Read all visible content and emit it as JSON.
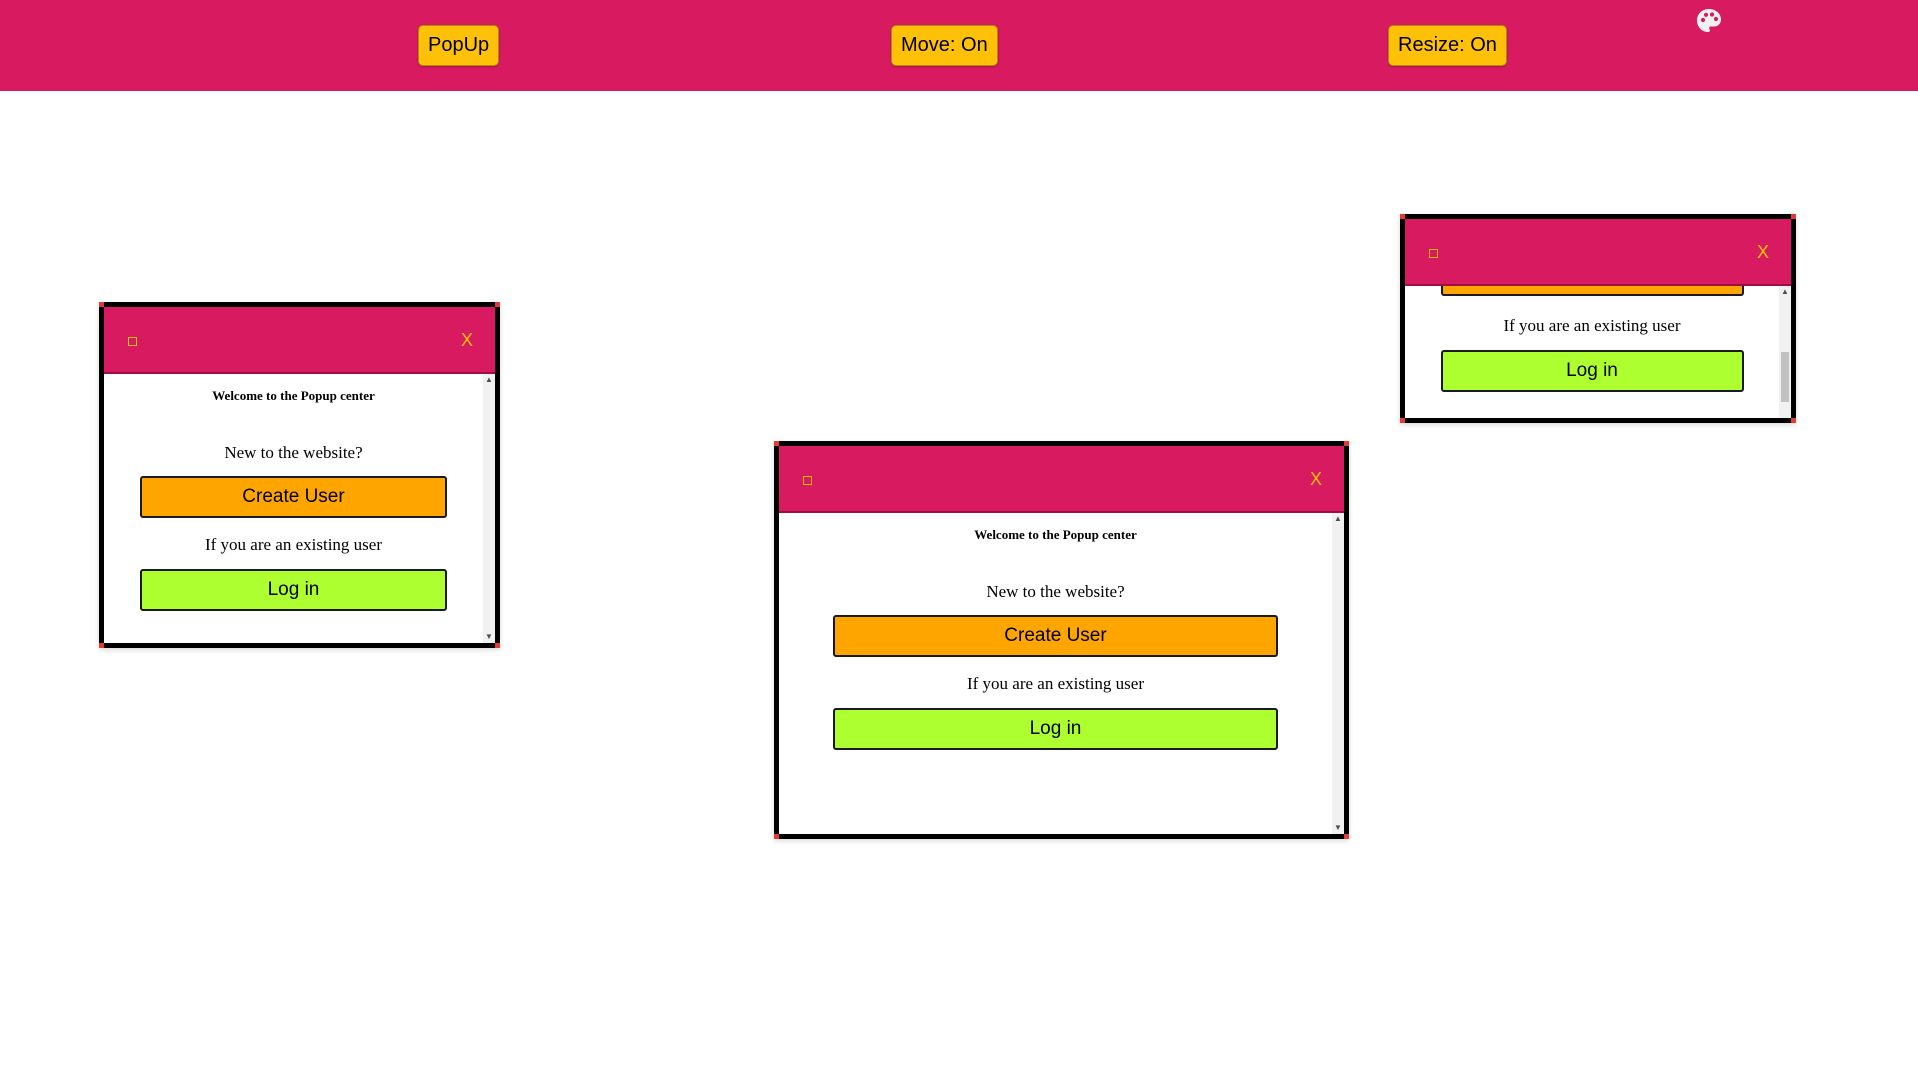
{
  "toolbar": {
    "popup_label": "PopUp",
    "move_label": "Move: On",
    "resize_label": "Resize: On",
    "theme_icon": "palette-icon"
  },
  "popups": [
    {
      "minimize_icon": "square-icon",
      "close_label": "X",
      "welcome": "Welcome to the Popup center",
      "new_question": "New to the website?",
      "create_label": "Create User",
      "existing_text": "If you are an existing user",
      "login_label": "Log in"
    },
    {
      "minimize_icon": "square-icon",
      "close_label": "X",
      "welcome": "Welcome to the Popup center",
      "new_question": "New to the website?",
      "create_label": "Create User",
      "existing_text": "If you are an existing user",
      "login_label": "Log in"
    },
    {
      "minimize_icon": "square-icon",
      "close_label": "X",
      "existing_text": "If you are an existing user",
      "login_label": "Log in"
    }
  ],
  "colors": {
    "brand": "#d81b60",
    "toolbar_button": "#ffc107",
    "create_button": "#ffa500",
    "login_button": "#adff2f",
    "close_x": "#ffc107"
  }
}
